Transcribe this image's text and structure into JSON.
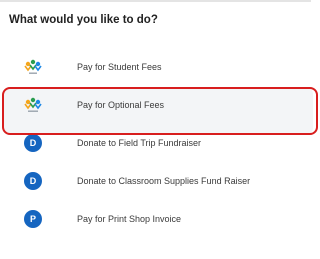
{
  "header": {
    "title": "What would you like to do?"
  },
  "options": [
    {
      "label": "Pay for Student Fees",
      "icon": "school-logo-icon",
      "icon_caption": "Fees"
    },
    {
      "label": "Pay for Optional Fees",
      "icon": "school-logo-icon",
      "icon_caption": "Fees"
    },
    {
      "label": "Donate to Field Trip Fundraiser",
      "icon": "letter-avatar-icon",
      "letter": "D",
      "color": "#1565c0"
    },
    {
      "label": "Donate to Classroom Supplies Fund Raiser",
      "icon": "letter-avatar-icon",
      "letter": "D",
      "color": "#1565c0"
    },
    {
      "label": "Pay for Print Shop Invoice",
      "icon": "letter-avatar-icon",
      "letter": "P",
      "color": "#1565c0"
    }
  ],
  "highlight": {
    "selected_index": 1,
    "color": "#d81e1e"
  }
}
